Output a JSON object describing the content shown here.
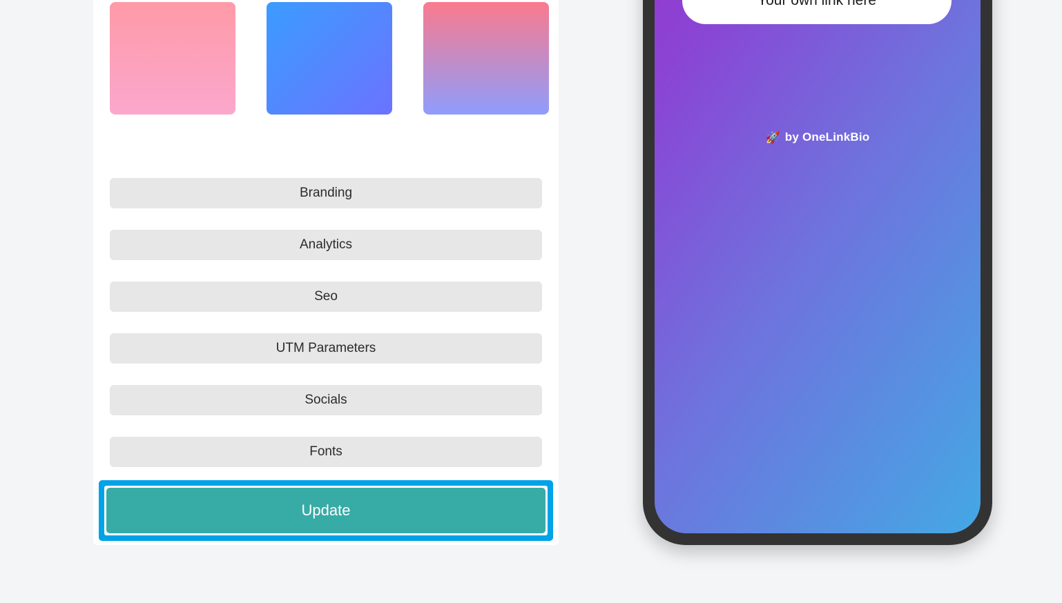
{
  "theme": {
    "accent_teal": "#37aba6",
    "focus_ring_blue": "#00a2e8",
    "button_grey": "#e7e7e7",
    "page_background": "#f4f5f7",
    "phone_bezel": "#333333"
  },
  "editor": {
    "swatches": [
      {
        "name": "purple-blue-gradient",
        "from": "#9b30c9",
        "to": "#4aa8e0",
        "angle": "90deg"
      },
      {
        "name": "orange-red-gradient",
        "from": "#ffb259",
        "to": "#f4514e",
        "angle": "90deg"
      },
      {
        "name": "teal-blue-gradient",
        "from": "#6cc6bd",
        "to": "#3b7bbf",
        "angle": "90deg"
      },
      {
        "name": "pink-rose-gradient",
        "from": "#ff9aa7",
        "to": "#fba7cd",
        "angle": "180deg"
      },
      {
        "name": "blue-indigo-gradient",
        "from": "#3b9cff",
        "to": "#6b73ff",
        "angle": "135deg"
      },
      {
        "name": "rose-periwinkle-gradient",
        "from": "#fa7a8d",
        "to": "#8f9dfc",
        "angle": "180deg"
      }
    ],
    "sections": [
      {
        "id": "branding",
        "label": "Branding"
      },
      {
        "id": "analytics",
        "label": "Analytics"
      },
      {
        "id": "seo",
        "label": "Seo"
      },
      {
        "id": "utm",
        "label": "UTM Parameters"
      },
      {
        "id": "socials",
        "label": "Socials"
      },
      {
        "id": "fonts",
        "label": "Fonts"
      }
    ],
    "update_button": {
      "label": "Update",
      "focused": true
    }
  },
  "preview": {
    "link_pill": {
      "label": "Your own link here"
    },
    "branding": {
      "icon": "rocket-icon",
      "icon_glyph": "🚀",
      "label": "by OneLinkBio"
    },
    "background_gradient": {
      "from": "#a32bc4",
      "to": "#44a8e4"
    }
  }
}
